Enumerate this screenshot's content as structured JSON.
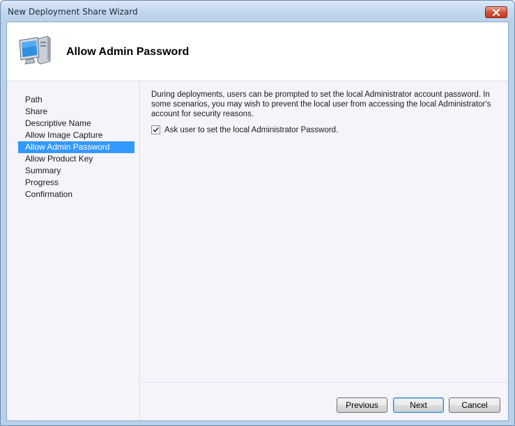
{
  "window": {
    "title": "New Deployment Share Wizard"
  },
  "header": {
    "title": "Allow Admin Password",
    "icon": "computer-icon"
  },
  "nav": {
    "items": [
      {
        "label": "Path"
      },
      {
        "label": "Share"
      },
      {
        "label": "Descriptive Name"
      },
      {
        "label": "Allow Image Capture"
      },
      {
        "label": "Allow Admin Password",
        "selected": true
      },
      {
        "label": "Allow Product Key"
      },
      {
        "label": "Summary"
      },
      {
        "label": "Progress"
      },
      {
        "label": "Confirmation"
      }
    ]
  },
  "content": {
    "description": "During deployments, users can be prompted to set the local Administrator account password. In some scenarios, you may wish to prevent the local user from accessing the local Administrator's account for security reasons.",
    "checkbox_label": "Ask user to set the local Administrator Password.",
    "checkbox_checked": true
  },
  "buttons": {
    "previous": "Previous",
    "next": "Next",
    "cancel": "Cancel"
  },
  "colors": {
    "selection": "#3399ff",
    "panel": "#f4f4fa",
    "frame": "#b9d1ea",
    "close": "#c4381c"
  }
}
